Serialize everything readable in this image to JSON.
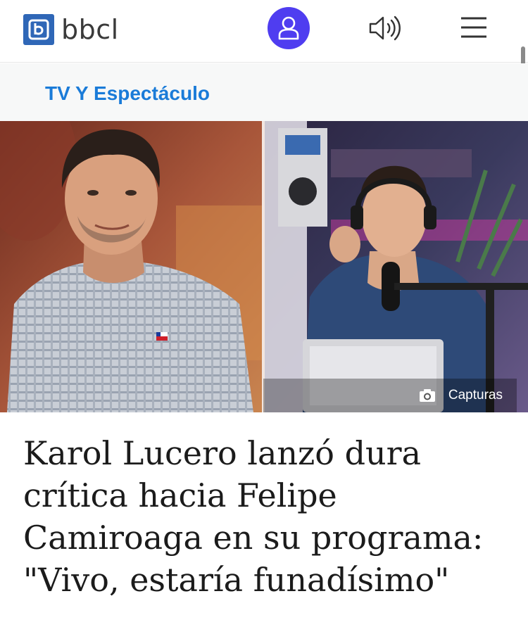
{
  "header": {
    "logo_text": "bbcl",
    "icons": [
      "bbcl-logo-icon",
      "user-icon",
      "speaker-icon",
      "hamburger-menu-icon"
    ],
    "accent_color": "#4f3df0",
    "logo_color": "#2f67b7"
  },
  "section": {
    "label": "TV Y Espectáculo",
    "color": "#1a7bd8"
  },
  "hero": {
    "caption": "Capturas",
    "caption_icon": "camera-icon"
  },
  "article": {
    "headline": "Karol Lucero lanzó dura crítica hacia Felipe Camiroaga en su programa: \"Vivo, estaría funadísimo\""
  }
}
